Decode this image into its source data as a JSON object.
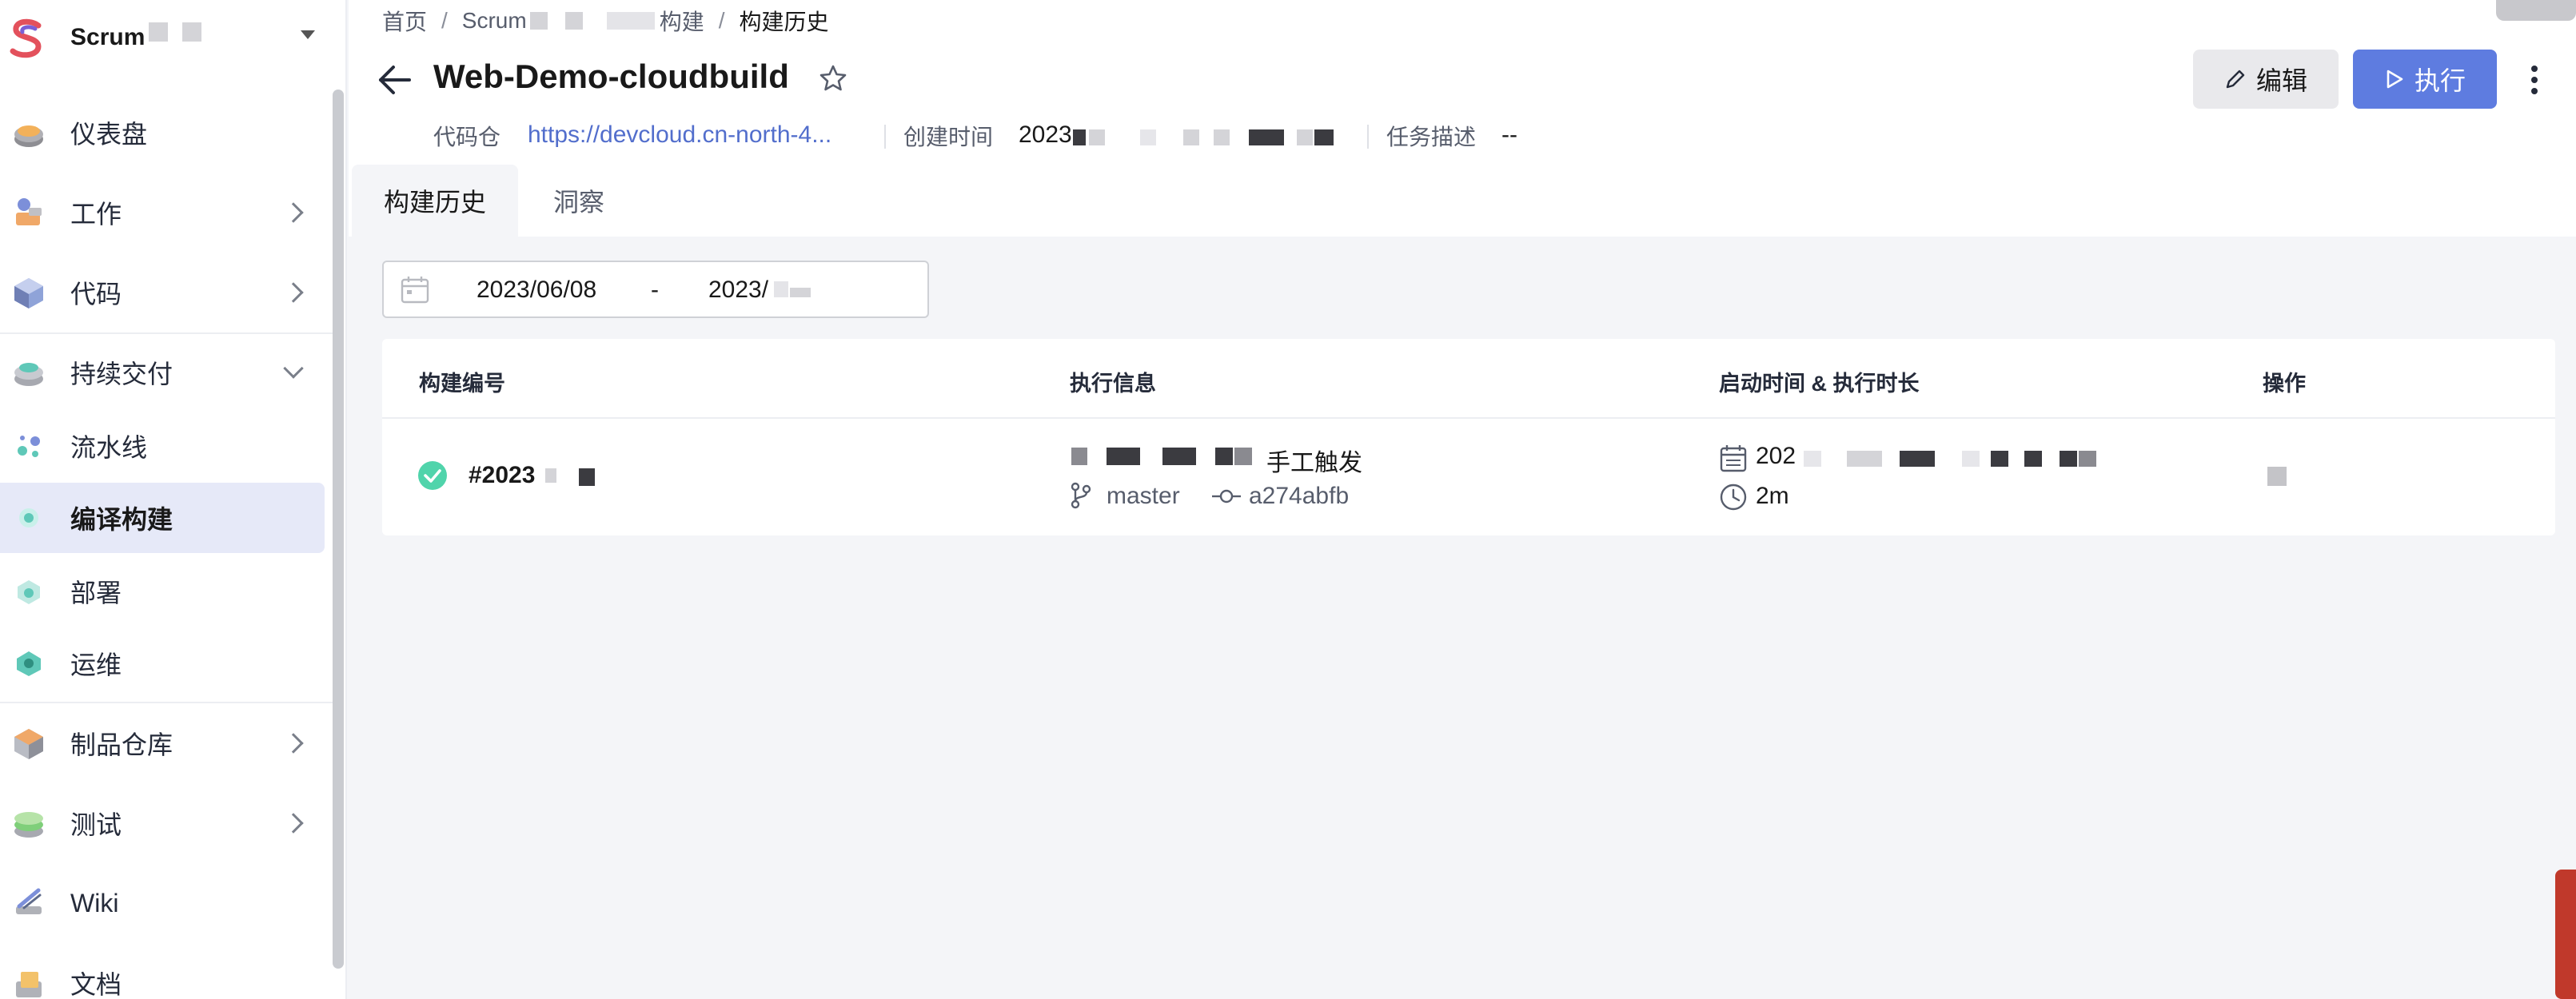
{
  "sidebar": {
    "project_name": "Scrum",
    "items": [
      {
        "label": "仪表盘",
        "icon": "dashboard-icon"
      },
      {
        "label": "工作",
        "icon": "work-icon"
      },
      {
        "label": "代码",
        "icon": "code-icon"
      },
      {
        "label": "持续交付",
        "icon": "continuous-delivery-icon"
      },
      {
        "label": "流水线",
        "icon": "pipeline-icon"
      },
      {
        "label": "编译构建",
        "icon": "build-icon"
      },
      {
        "label": "部署",
        "icon": "deploy-icon"
      },
      {
        "label": "运维",
        "icon": "operations-icon"
      },
      {
        "label": "制品仓库",
        "icon": "artifact-repo-icon"
      },
      {
        "label": "测试",
        "icon": "test-icon"
      },
      {
        "label": "Wiki",
        "icon": "wiki-icon"
      },
      {
        "label": "文档",
        "icon": "docs-icon"
      }
    ]
  },
  "breadcrumb": {
    "home": "首页",
    "project": "Scrum",
    "module": "构建",
    "current": "构建历史"
  },
  "header": {
    "title": "Web-Demo-cloudbuild",
    "repo_label": "代码仓",
    "repo_url": "https://devcloud.cn-north-4...",
    "created_label": "创建时间",
    "created_value": "2023",
    "desc_label": "任务描述",
    "desc_value": "--",
    "edit_label": "编辑",
    "run_label": "执行"
  },
  "tabs": [
    "构建历史",
    "洞察"
  ],
  "date_range": {
    "start": "2023/06/08",
    "separator": "-",
    "end": "2023/"
  },
  "table": {
    "columns": [
      "构建编号",
      "执行信息",
      "启动时间 & 执行时长",
      "操作"
    ],
    "rows": [
      {
        "build_no": "#2023",
        "trigger": "手工触发",
        "branch": "master",
        "commit": "a274abfb",
        "start_time": "202",
        "duration": "2m"
      }
    ]
  },
  "colors": {
    "primary": "#5e7ce0",
    "success": "#50d4ab",
    "link": "#526ecc",
    "active_bg": "#e6e9f8"
  }
}
